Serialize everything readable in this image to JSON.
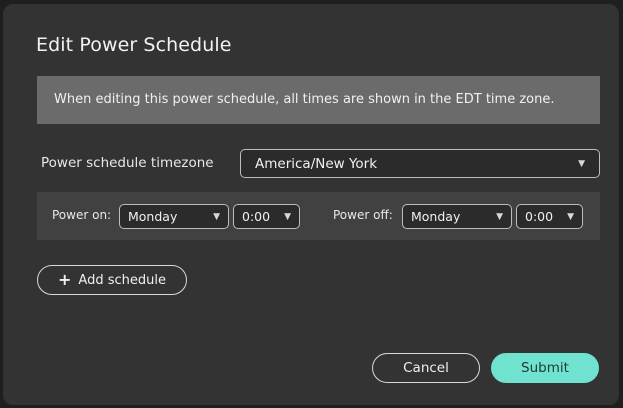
{
  "dialog": {
    "title": "Edit Power Schedule",
    "notice": "When editing this power schedule, all times are shown in the EDT time zone.",
    "timezone_label": "Power schedule timezone",
    "timezone_value": "America/New York"
  },
  "schedule": {
    "power_on_label": "Power on:",
    "power_on_day": "Monday",
    "power_on_time": "0:00",
    "power_off_label": "Power off:",
    "power_off_day": "Monday",
    "power_off_time": "0:00"
  },
  "actions": {
    "add_schedule_label": "Add schedule",
    "add_schedule_icon": "+",
    "cancel_label": "Cancel",
    "submit_label": "Submit"
  },
  "icons": {
    "caret": "▼"
  },
  "colors": {
    "accent": "#6fe3cf",
    "notice_bg": "#6b6b6b",
    "panel_bg": "#333333"
  }
}
